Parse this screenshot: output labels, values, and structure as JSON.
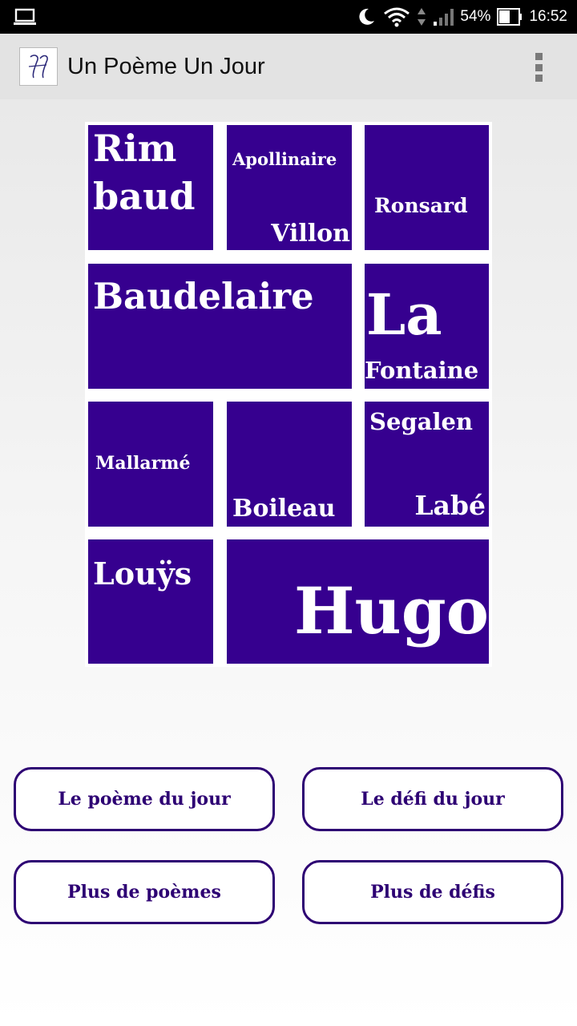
{
  "status_bar": {
    "battery": "54%",
    "time": "16:52"
  },
  "app_bar": {
    "title": "Un Poème Un Jour"
  },
  "poster": {
    "rimbaud_1": "Rim",
    "rimbaud_2": "baud",
    "apollinaire": "Apollinaire",
    "villon": "Villon",
    "ronsard": "Ronsard",
    "baudelaire": "Baudelaire",
    "la": "La",
    "fontaine": "Fontaine",
    "mallarme": "Mallarmé",
    "boileau": "Boileau",
    "segalen": "Segalen",
    "labe": "Labé",
    "louys": "Louÿs",
    "hugo": "Hugo",
    "tile_color": "#36008f"
  },
  "buttons": {
    "poem_of_day": "Le poème du jour",
    "challenge_of_day": "Le défi du jour",
    "more_poems": "Plus de poèmes",
    "more_challenges": "Plus de défis"
  }
}
